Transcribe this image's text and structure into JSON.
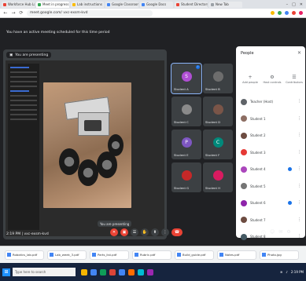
{
  "browser": {
    "tabs": [
      {
        "label": "Workforce Hub Labs",
        "color": "#ea4335"
      },
      {
        "label": "Meet in progress",
        "color": "#34a853",
        "active": true
      },
      {
        "label": "Lab instructions",
        "color": "#fbbc04"
      },
      {
        "label": "Google Classroom",
        "color": "#4285f4"
      },
      {
        "label": "Google Docs",
        "color": "#4285f4"
      },
      {
        "label": "Student Directory",
        "color": "#ea4335"
      },
      {
        "label": "New Tab",
        "color": "#9aa0a6"
      }
    ],
    "url": "meet.google.com/ vxc-exsm-kvd",
    "window_controls": [
      "–",
      "□",
      "✕"
    ],
    "nav": [
      "←",
      "→",
      "⟳"
    ]
  },
  "meet": {
    "banner": "You have an active meeting scheduled for this time period",
    "presenting_label": "You are presenting",
    "tooltip": "You are presenting",
    "meeting_code": "2:19 PM | vxc-exsm-kvd",
    "tiles": [
      {
        "name": "Student A",
        "initial": "S",
        "color": "#b04fd3",
        "speaking": true
      },
      {
        "name": "Student B",
        "initial": "",
        "color": "#6d6d6d"
      },
      {
        "name": "Student C",
        "initial": "",
        "color": "#8a8a8a"
      },
      {
        "name": "Student D",
        "initial": "",
        "color": "#7a5548"
      },
      {
        "name": "Student E",
        "initial": "P",
        "color": "#7e57c2"
      },
      {
        "name": "Student F",
        "initial": "C",
        "color": "#00897b"
      },
      {
        "name": "Student G",
        "initial": "",
        "color": "#c62828"
      },
      {
        "name": "Student H",
        "initial": "",
        "color": "#d81b60"
      }
    ],
    "controls": [
      {
        "icon": "mic-off-icon",
        "glyph": "✕"
      },
      {
        "icon": "camera-off-icon",
        "glyph": "▣"
      },
      {
        "icon": "captions-icon",
        "glyph": "☰"
      },
      {
        "icon": "raise-hand-icon",
        "glyph": "✋"
      },
      {
        "icon": "present-icon",
        "glyph": "⬆"
      },
      {
        "icon": "more-icon",
        "glyph": "⋮"
      }
    ],
    "right_controls": [
      "ⓘ",
      "☺",
      "✉",
      "⚙"
    ]
  },
  "people": {
    "title": "People",
    "close": "✕",
    "tabs": [
      {
        "label": "Add people",
        "glyph": "+"
      },
      {
        "label": "Host controls",
        "glyph": "⚙"
      },
      {
        "label": "Contributors",
        "glyph": "☰"
      }
    ],
    "participants": [
      {
        "name": "Teacher (Host)",
        "color": "#5f6368",
        "initial": "",
        "mic": false
      },
      {
        "name": "Student 1",
        "color": "#8d6e63",
        "initial": "",
        "mic": false
      },
      {
        "name": "Student 2",
        "color": "#6d4c41",
        "initial": "",
        "mic": false
      },
      {
        "name": "Student 3",
        "color": "#e53935",
        "initial": "",
        "mic": false
      },
      {
        "name": "Student 4",
        "color": "#ab47bc",
        "initial": "",
        "mic": true
      },
      {
        "name": "Student 5",
        "color": "#757575",
        "initial": "",
        "mic": false
      },
      {
        "name": "Student 6",
        "color": "#8e24aa",
        "initial": "",
        "mic": true
      },
      {
        "name": "Student 7",
        "color": "#6d4c41",
        "initial": "",
        "mic": false
      },
      {
        "name": "Student 8",
        "color": "#455a64",
        "initial": "",
        "mic": false
      }
    ]
  },
  "downloads": [
    "Robotics_lab.pdf",
    "Lab_week_3.pdf",
    "Parts_list.pdf",
    "Rubric.pdf",
    "Build_guide.pdf",
    "Notes.pdf",
    "Photo.jpg"
  ],
  "taskbar": {
    "start_glyph": "⊞",
    "search_placeholder": "Type here to search",
    "apps": [
      "#f4b400",
      "#4285f4",
      "#0f9d58",
      "#db4437",
      "#4285f4",
      "#ff6d00",
      "#00bcd4",
      "#9c27b0"
    ],
    "tray_text": "2:19 PM"
  }
}
